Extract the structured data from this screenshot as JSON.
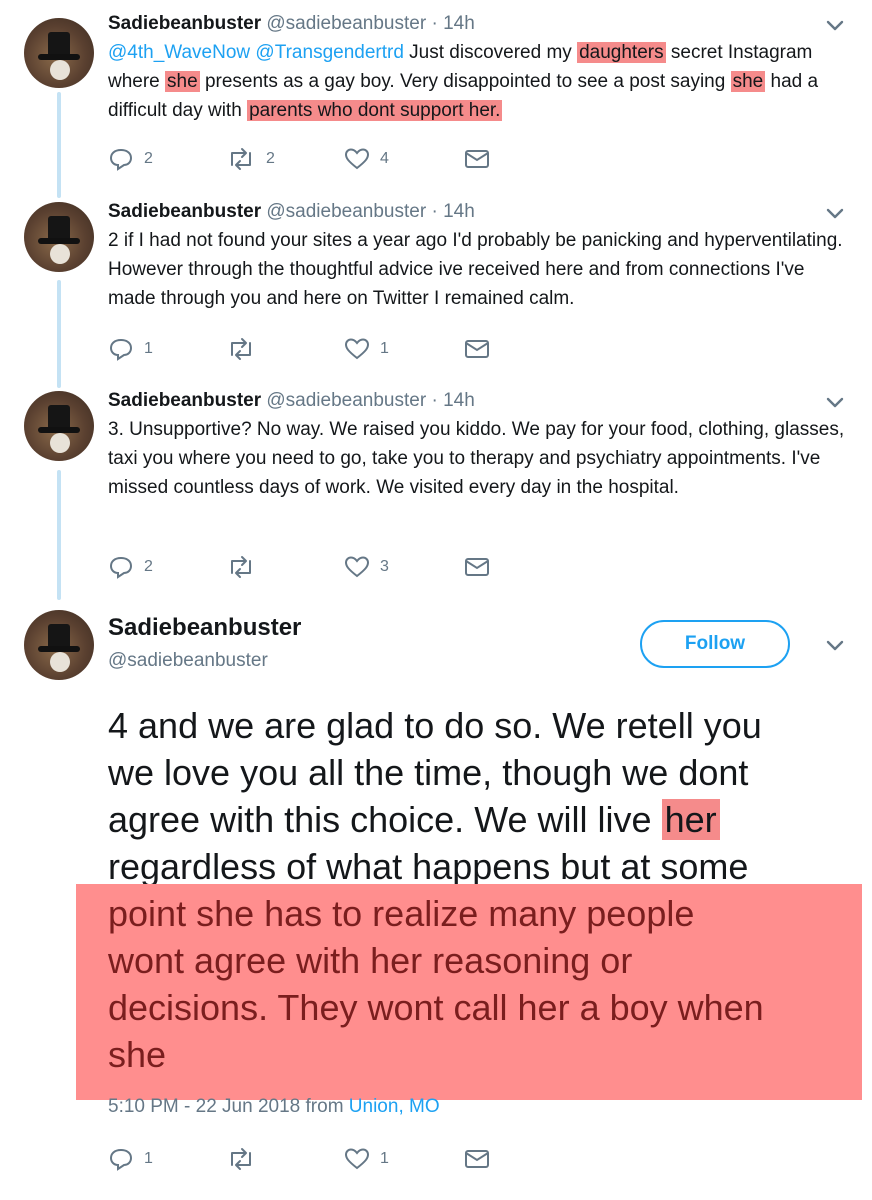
{
  "tweets": [
    {
      "name": "Sadiebeanbuster",
      "handle": "@sadiebeanbuster",
      "dot": "·",
      "time": "14h",
      "body": [
        {
          "t": "@4th_WaveNow @Transgendertrd",
          "s": "mention"
        },
        {
          "t": " Just discovered my ",
          "s": ""
        },
        {
          "t": "daughters",
          "s": "hl"
        },
        {
          "t": " secret Instagram where ",
          "s": ""
        },
        {
          "t": "she",
          "s": "hl"
        },
        {
          "t": " presents as a gay boy. Very disappointed to see a post saying ",
          "s": ""
        },
        {
          "t": "she",
          "s": "hl"
        },
        {
          "t": " had a difficult day with ",
          "s": ""
        },
        {
          "t": "parents who dont support her.",
          "s": "hl"
        }
      ],
      "replies": "2",
      "retweets": "2",
      "likes": "4"
    },
    {
      "name": "Sadiebeanbuster",
      "handle": "@sadiebeanbuster",
      "dot": "·",
      "time": "14h",
      "body": [
        {
          "t": "2 if I had not found your sites a year ago I'd probably be panicking and hyperventilating. However through the thoughtful advice ive received here and from connections I've made through you and here on Twitter I remained calm.",
          "s": ""
        }
      ],
      "replies": "1",
      "retweets": "",
      "likes": "1"
    },
    {
      "name": "Sadiebeanbuster",
      "handle": "@sadiebeanbuster",
      "dot": "·",
      "time": "14h",
      "body": [
        {
          "t": "3. Unsupportive? No way. We raised you kiddo. We pay for your food, clothing, glasses, taxi you where you need to go, take you to therapy and psychiatry appointments. I've missed countless days of work. We visited every day in the hospital.",
          "s": ""
        }
      ],
      "replies": "2",
      "retweets": "",
      "likes": "3"
    }
  ],
  "main_tweet": {
    "name": "Sadiebeanbuster",
    "handle": "@sadiebeanbuster",
    "follow_label": "Follow",
    "lines": [
      "4 and we are glad to do so. We retell you",
      "we love you all the time, though we dont",
      "agree with this choice. We will live",
      "her",
      "regardless of what happens but at some"
    ],
    "highlighted_lines": [
      "point she has to realize many people",
      "wont agree with her reasoning or",
      "decisions. They wont call her a boy when",
      "she"
    ],
    "meta_time": "5:10 PM - 22 Jun 2018 from ",
    "meta_location": "Union, MO",
    "replies": "1",
    "retweets": "",
    "likes": "1"
  },
  "colors": {
    "accent": "#1da1f2",
    "highlight": "#f58b8b",
    "overlay": "#ff8e8e",
    "muted": "#657786"
  },
  "icons": [
    "reply-icon",
    "retweet-icon",
    "like-icon",
    "message-icon",
    "chevron-down-icon"
  ]
}
